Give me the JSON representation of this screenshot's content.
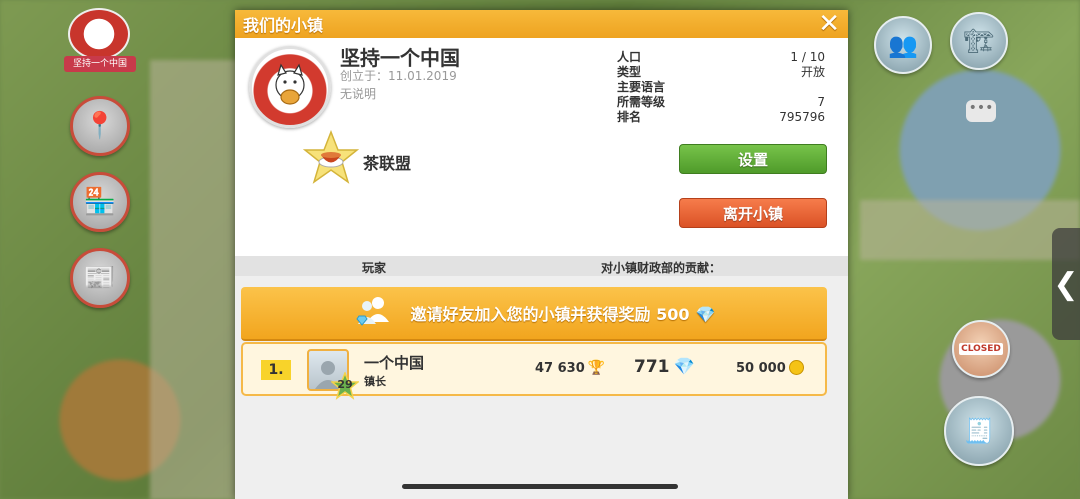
{
  "background": {
    "town_name_badge": "坚持一个中国",
    "closed_sign": "CLOSED"
  },
  "dialog": {
    "title": "我们的小镇",
    "close_label": "✕",
    "town": {
      "name": "坚持一个中国",
      "created": "创立于：11.01.2019",
      "description": "无说明"
    },
    "stats": [
      {
        "label": "人口",
        "value": "1 / 10"
      },
      {
        "label": "类型",
        "value": "开放"
      },
      {
        "label": "主要语言",
        "value": ""
      },
      {
        "label": "所需等级",
        "value": "7"
      },
      {
        "label": "排名",
        "value": "795796"
      }
    ],
    "alliance": {
      "name": "茶联盟",
      "icon": "tea-cup-icon"
    },
    "buttons": {
      "settings": "设置",
      "leave": "离开小镇"
    },
    "columns": {
      "player": "玩家",
      "contribution": "对小镇财政部的贡献："
    },
    "invite": {
      "text": "邀请好友加入您的小镇并获得奖励 500",
      "icon": "invite-friends-icon"
    },
    "members": [
      {
        "rank": "1.",
        "name": "一个中国",
        "role": "镇长",
        "level": "29",
        "trophies": "47 630",
        "gems": "771",
        "coins": "50 000"
      }
    ]
  },
  "colors": {
    "header": "#f2a623",
    "settings_button": "#5aa834",
    "leave_button": "#e45c2e",
    "invite_banner": "#f5b02c"
  }
}
